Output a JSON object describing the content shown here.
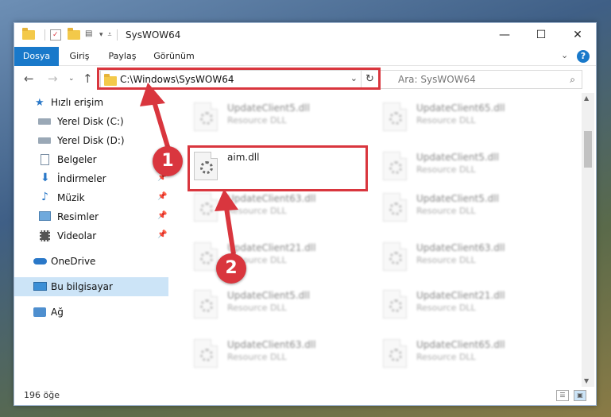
{
  "window": {
    "title": "SysWOW64",
    "controls": {
      "minimize": "—",
      "maximize": "☐",
      "close": "✕"
    }
  },
  "ribbon": {
    "tabs": [
      {
        "label": "Dosya",
        "active": true
      },
      {
        "label": "Giriş",
        "active": false
      },
      {
        "label": "Paylaş",
        "active": false
      },
      {
        "label": "Görünüm",
        "active": false
      }
    ],
    "expand_icon": "chevron-down-icon",
    "help_label": "?"
  },
  "address": {
    "path": "C:\\Windows\\SysWOW64",
    "search_placeholder": "Ara: SysWOW64"
  },
  "navpane": {
    "items": [
      {
        "label": "Hızlı erişim",
        "icon": "star-icon",
        "pinned": false
      },
      {
        "label": "Yerel Disk (C:)",
        "icon": "drive-icon",
        "pinned": false
      },
      {
        "label": "Yerel Disk (D:)",
        "icon": "drive-icon",
        "pinned": false
      },
      {
        "label": "Belgeler",
        "icon": "document-icon",
        "pinned": false
      },
      {
        "label": "İndirmeler",
        "icon": "download-icon",
        "pinned": true
      },
      {
        "label": "Müzik",
        "icon": "music-icon",
        "pinned": true
      },
      {
        "label": "Resimler",
        "icon": "pictures-icon",
        "pinned": true
      },
      {
        "label": "Videolar",
        "icon": "video-icon",
        "pinned": true
      },
      {
        "label": "OneDrive",
        "icon": "cloud-icon",
        "pinned": false
      },
      {
        "label": "Bu bilgisayar",
        "icon": "computer-icon",
        "pinned": false,
        "selected": true
      },
      {
        "label": "Ağ",
        "icon": "network-icon",
        "pinned": false
      }
    ]
  },
  "files": {
    "highlighted": {
      "name": "aim.dll",
      "type": ""
    },
    "left_column": [
      {
        "name": "UpdateClient5.dll",
        "type": "Resource DLL"
      },
      {
        "name": "UpdateClient63.dll",
        "type": "Resource DLL"
      },
      {
        "name": "UpdateClient21.dll",
        "type": "Resource DLL"
      },
      {
        "name": "UpdateClient5.dll",
        "type": "Resource DLL"
      },
      {
        "name": "UpdateClient63.dll",
        "type": "Resource DLL"
      }
    ],
    "right_column": [
      {
        "name": "UpdateClient65.dll",
        "type": "Resource DLL"
      },
      {
        "name": "UpdateClient5.dll",
        "type": "Resource DLL"
      },
      {
        "name": "UpdateClient5.dll",
        "type": "Resource DLL"
      },
      {
        "name": "UpdateClient63.dll",
        "type": "Resource DLL"
      },
      {
        "name": "UpdateClient21.dll",
        "type": "Resource DLL"
      },
      {
        "name": "UpdateClient65.dll",
        "type": "Resource DLL"
      }
    ]
  },
  "status": {
    "item_count": "196 öğe"
  },
  "annotations": {
    "step1": "1",
    "step2": "2",
    "color": "#d9363e"
  }
}
